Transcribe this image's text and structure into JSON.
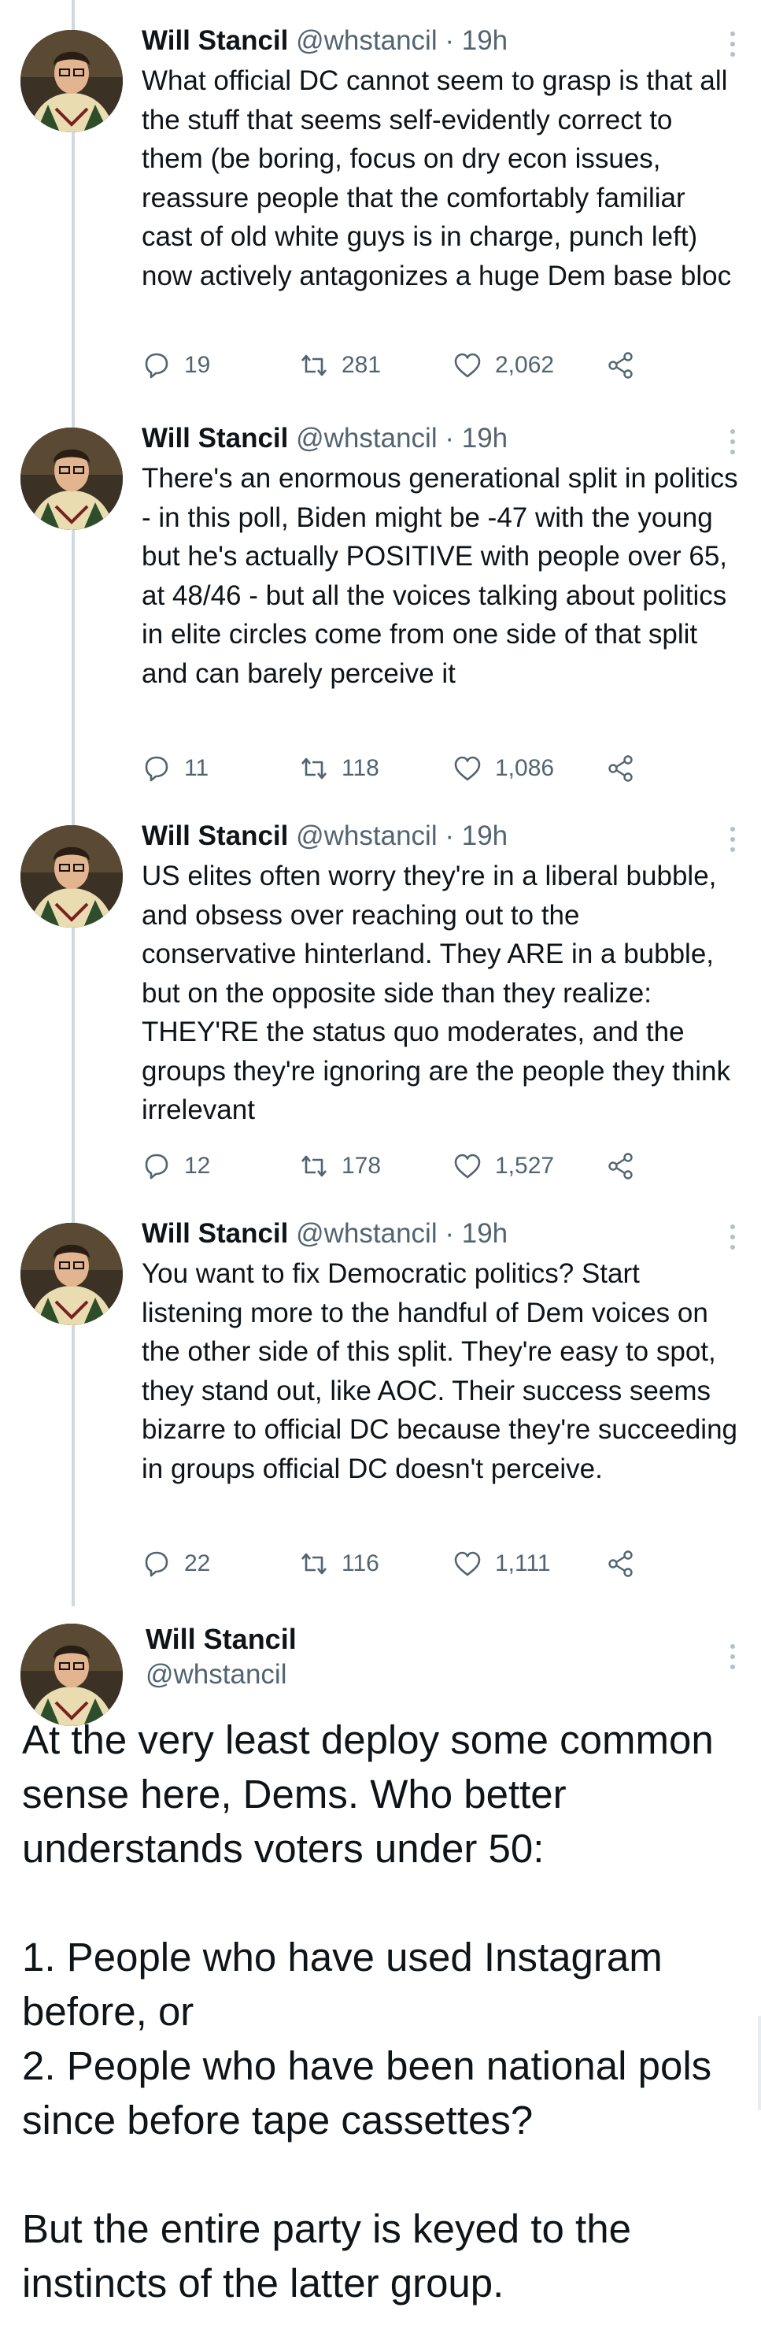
{
  "thread": [
    {
      "name": "Will Stancil",
      "handle": "@whstancil",
      "separator": "·",
      "time": "19h",
      "text": "What official DC cannot seem to grasp is that all the stuff that seems self-evidently correct to them (be boring, focus on dry econ issues, reassure people that the comfortably familiar cast of old white guys is in charge, punch left) now actively antagonizes a huge Dem base bloc",
      "replies": "19",
      "retweets": "281",
      "likes": "2,062"
    },
    {
      "name": "Will Stancil",
      "handle": "@whstancil",
      "separator": "·",
      "time": "19h",
      "text": "There's an enormous generational split in politics - in this poll, Biden might be -47 with the young but he's actually POSITIVE with people over 65, at 48/46 - but all the voices talking about politics in elite circles come from one side of that split and can barely perceive it",
      "replies": "11",
      "retweets": "118",
      "likes": "1,086"
    },
    {
      "name": "Will Stancil",
      "handle": "@whstancil",
      "separator": "·",
      "time": "19h",
      "text": "US elites often worry they're in a liberal bubble, and obsess over reaching out to the conservative hinterland. They ARE in a bubble, but on the opposite side than they realize: THEY'RE the status quo moderates, and the groups they're ignoring are the people they think irrelevant",
      "replies": "12",
      "retweets": "178",
      "likes": "1,527"
    },
    {
      "name": "Will Stancil",
      "handle": "@whstancil",
      "separator": "·",
      "time": "19h",
      "text": "You want to fix Democratic politics? Start listening more to the handful of Dem voices on the other side of this split. They're easy to spot, they stand out, like AOC. Their success seems bizarre to official DC because they're succeeding in groups official DC doesn't perceive.",
      "replies": "22",
      "retweets": "116",
      "likes": "1,111"
    }
  ],
  "main_tweet": {
    "name": "Will Stancil",
    "handle": "@whstancil",
    "paragraph1": "At the very least deploy some common sense here, Dems. Who better understands voters under 50:",
    "item1": "1. People who have used Instagram before, or",
    "item2": "2. People who have been national pols since before tape cassettes?",
    "paragraph3": "But the entire party is keyed to the instincts of the latter group."
  },
  "icons": [
    "reply-icon",
    "retweet-icon",
    "like-icon",
    "share-icon",
    "more-icon"
  ],
  "colors": {
    "text": "#0f1419",
    "secondary": "#536471",
    "thread_line": "#cfd9de",
    "background": "#ffffff"
  }
}
